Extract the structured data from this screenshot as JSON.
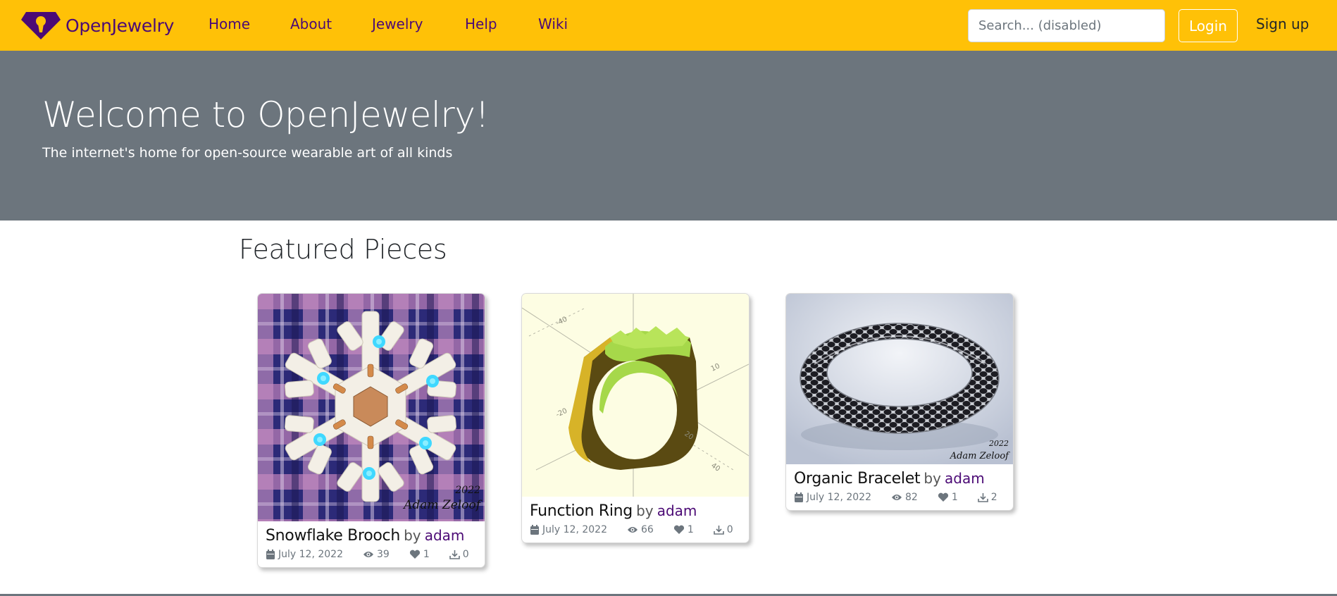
{
  "navbar": {
    "brand": "OpenJewelry",
    "links": [
      "Home",
      "About",
      "Jewelry",
      "Help",
      "Wiki"
    ],
    "search_placeholder": "Search... (disabled)",
    "login_label": "Login",
    "signup_label": "Sign up"
  },
  "hero": {
    "title": "Welcome to OpenJewelry!",
    "subtitle": "The internet's home for open-source wearable art of all kinds"
  },
  "featured": {
    "title": "Featured Pieces",
    "cards": [
      {
        "title": "Snowflake Brooch",
        "by": "by",
        "author": "adam",
        "date": "July 12, 2022",
        "views": "39",
        "likes": "1",
        "downloads": "0",
        "watermark_year": "2022",
        "watermark_name": "Adam Zeloof"
      },
      {
        "title": "Function Ring",
        "by": "by",
        "author": "adam",
        "date": "July 12, 2022",
        "views": "66",
        "likes": "1",
        "downloads": "0"
      },
      {
        "title": "Organic Bracelet",
        "by": "by",
        "author": "adam",
        "date": "July 12, 2022",
        "views": "82",
        "likes": "1",
        "downloads": "2",
        "watermark_year": "2022",
        "watermark_name": "Adam Zeloof"
      }
    ]
  },
  "colors": {
    "navbar_bg": "#ffc107",
    "brand_purple": "#4b0a75",
    "hero_bg": "#6c757d"
  },
  "icons": [
    "gem-logo-icon",
    "calendar-icon",
    "eye-icon",
    "heart-icon",
    "download-icon"
  ]
}
